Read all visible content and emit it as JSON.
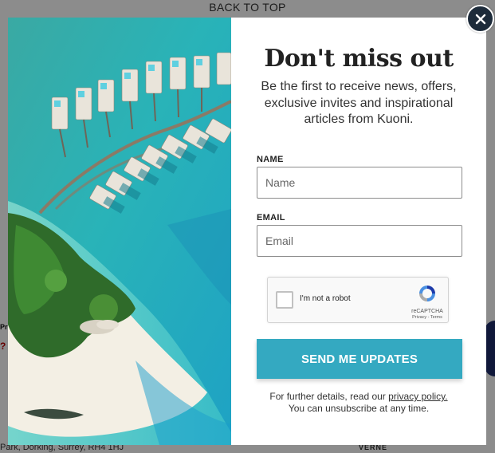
{
  "background": {
    "back_to_top": "BACK TO TOP",
    "address_fragment": "Park, Dorking, Surrey, RH4 1HJ",
    "badge_fragment": "VERNE"
  },
  "modal": {
    "title": "Don't miss out",
    "subtitle": "Be the first to receive news, offers, exclusive invites and inspirational articles from Kuoni.",
    "name_label": "NAME",
    "name_placeholder": "Name",
    "name_value": "",
    "email_label": "EMAIL",
    "email_placeholder": "Email",
    "email_value": "",
    "recaptcha": {
      "label": "I'm not a robot",
      "brand": "reCAPTCHA",
      "links": "Privacy - Terms"
    },
    "submit_label": "SEND ME UPDATES",
    "footer_prefix": "For further details, read our ",
    "privacy_link": "privacy policy.",
    "footer_line2": "You can unsubscribe at any time.",
    "close_icon": "close-icon"
  },
  "colors": {
    "accent_button": "#34a9c1",
    "close_button": "#1d2b3a",
    "overlay": "rgba(0,0,0,0.45)"
  }
}
